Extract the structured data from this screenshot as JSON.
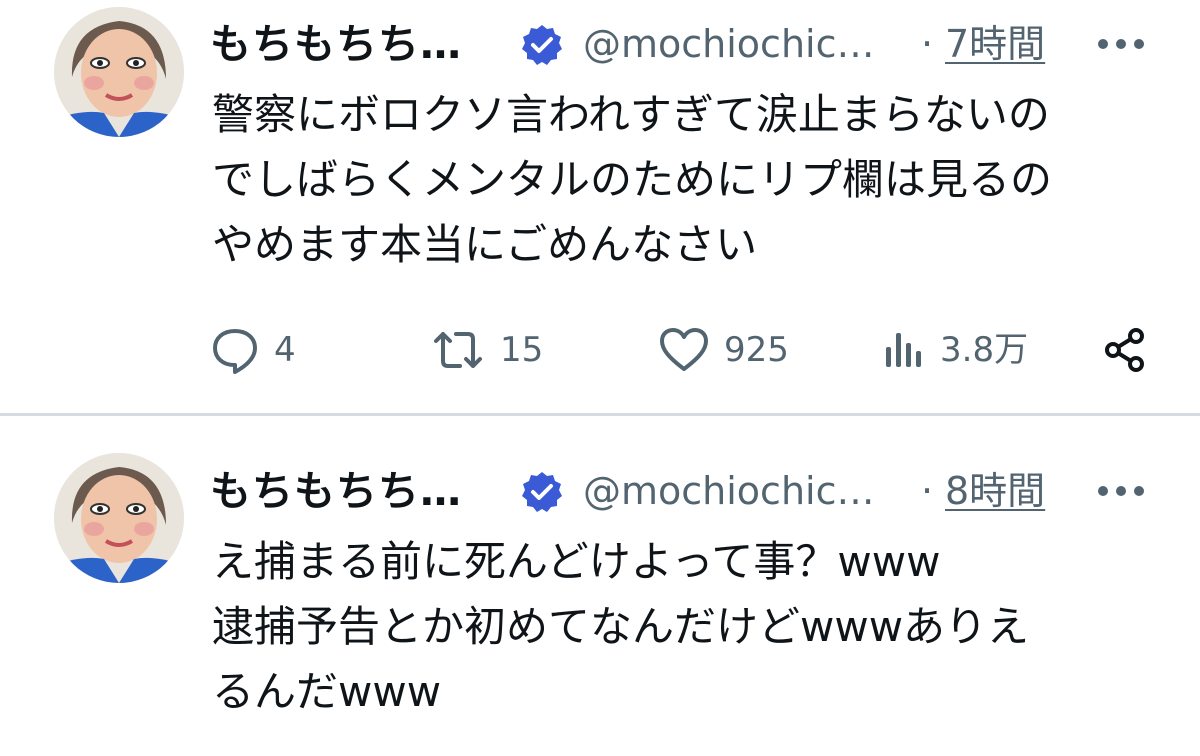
{
  "colors": {
    "text": "#0f1419",
    "secondary": "#536471",
    "verified": "#3a5ad6",
    "divider": "#d5dbe2"
  },
  "tweets": [
    {
      "author": {
        "name": "もちもちち…",
        "handle": "@mochiochic…",
        "verified": true
      },
      "separator": "·",
      "time": "7時間",
      "body_lines": [
        "警察にボロクソ言われすぎて涙止まらないの",
        "でしばらくメンタルのためにリプ欄は見るの",
        "やめます本当にごめんなさい"
      ],
      "actions": {
        "reply": {
          "icon": "reply-icon",
          "count": "4"
        },
        "repost": {
          "icon": "repost-icon",
          "count": "15"
        },
        "like": {
          "icon": "heart-icon",
          "count": "925"
        },
        "views": {
          "icon": "analytics-icon",
          "count": "3.8万"
        },
        "share": {
          "icon": "share-icon"
        }
      }
    },
    {
      "author": {
        "name": "もちもちち…",
        "handle": "@mochiochic…",
        "verified": true
      },
      "separator": "·",
      "time": "8時間",
      "body_lines": [
        "え捕まる前に死んどけよって事？www",
        "逮捕予告とか初めてなんだけどwwwありえ",
        "るんだwww"
      ]
    }
  ]
}
